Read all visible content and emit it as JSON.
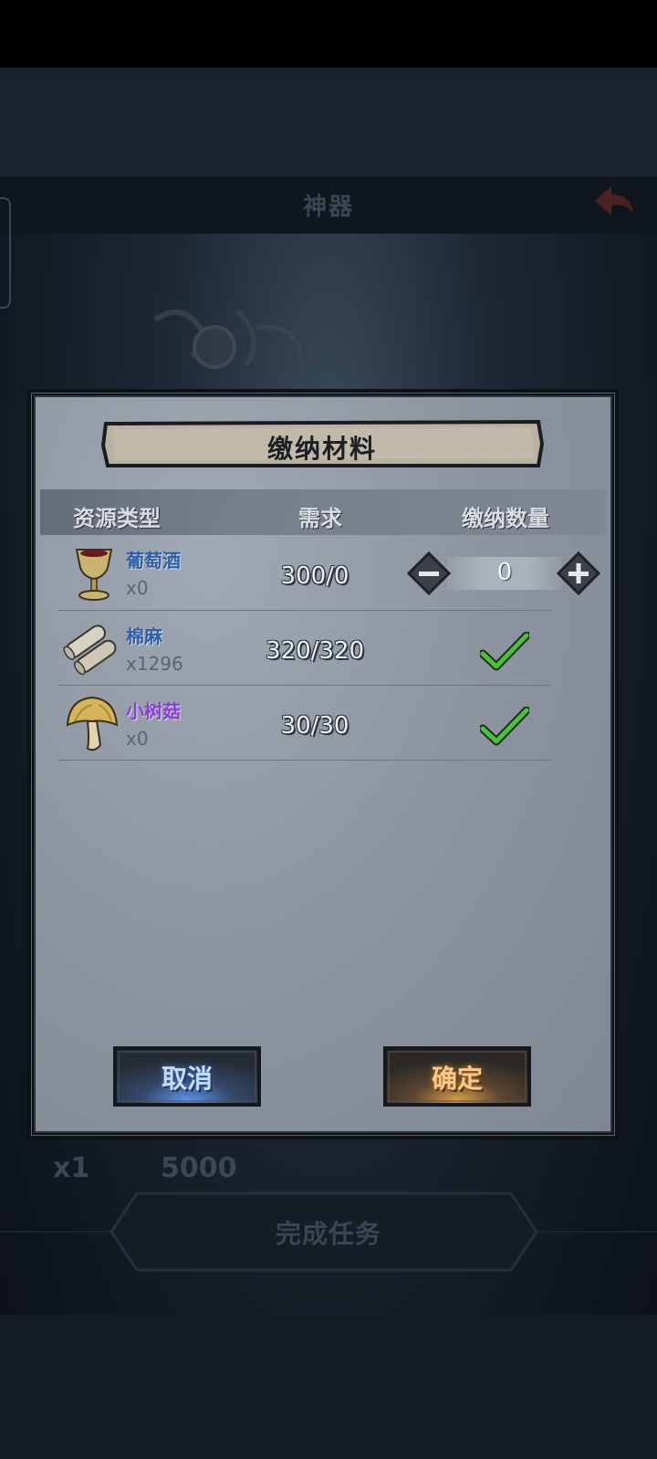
{
  "background": {
    "header_title": "神器",
    "stat_left": "x1",
    "stat_right": "5000",
    "complete_button": "完成任务"
  },
  "dialog": {
    "title": "缴纳材料",
    "columns": {
      "resource_type": "资源类型",
      "required": "需求",
      "submit_qty": "缴纳数量"
    },
    "rows": [
      {
        "name": "葡萄酒",
        "owned": "x0",
        "required": "300/0",
        "submit_value": "0",
        "icon": "goblet-icon"
      },
      {
        "name": "棉麻",
        "owned": "x1296",
        "required": "320/320",
        "status": "check",
        "icon": "cloth-roll-icon"
      },
      {
        "name": "小树菇",
        "owned": "x0",
        "required": "30/30",
        "status": "check",
        "icon": "mushroom-icon"
      }
    ],
    "cancel_label": "取消",
    "confirm_label": "确定"
  },
  "colors": {
    "item_name_blue": "#2d5fa8",
    "item_name_purple": "#8a3fd6",
    "check_green": "#47c23a",
    "cancel_glow": "#4a86e8",
    "confirm_glow": "#e0a040"
  }
}
